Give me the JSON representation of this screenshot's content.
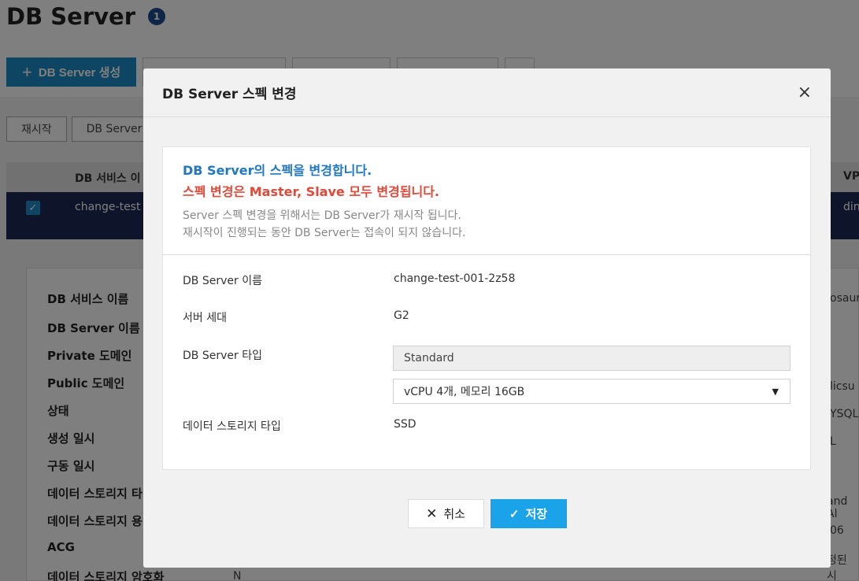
{
  "page": {
    "title": "DB Server",
    "badge": "1",
    "create_button": "DB Server 생성",
    "toolbar_buttons": [
      "",
      "",
      "",
      ""
    ],
    "sub_buttons": [
      "재시작",
      "DB Server"
    ],
    "table_headers": [
      "DB 서비스 이",
      "VP"
    ],
    "row": {
      "name": "change-test",
      "right": "din"
    },
    "detail_labels": [
      "DB 서비스 이름",
      "DB Server 이름",
      "Private 도메인",
      "Public 도메인",
      "상태",
      "생성 일시",
      "구동 일시",
      "데이터 스토리지 타",
      "데이터 스토리지 용",
      "ACG",
      "데이터 스토리지 암호화"
    ],
    "detail_right": [
      "osaur",
      "licsu",
      "YSQL8",
      "L",
      "and Al",
      "06",
      "정된 시"
    ],
    "detail_value_n": "N"
  },
  "modal": {
    "title": "DB Server 스펙 변경",
    "close_icon": "×",
    "notice_blue": "DB Server의 스펙을 변경합니다.",
    "notice_red": "스펙 변경은 Master, Slave 모두 변경됩니다.",
    "notice_gray_1": "Server 스펙 변경을 위해서는 DB Server가 재시작 됩니다.",
    "notice_gray_2": "재시작이 진행되는 동안 DB Server는 접속이 되지 않습니다.",
    "fields": {
      "server_name_label": "DB Server 이름",
      "server_name_value": "change-test-001-2z58",
      "generation_label": "서버 세대",
      "generation_value": "G2",
      "type_label": "DB Server 타입",
      "type_value": "Standard",
      "spec_value": "vCPU 4개, 메모리 16GB",
      "storage_label": "데이터 스토리지 타입",
      "storage_value": "SSD"
    },
    "cancel_label": "취소",
    "save_label": "저장"
  }
}
